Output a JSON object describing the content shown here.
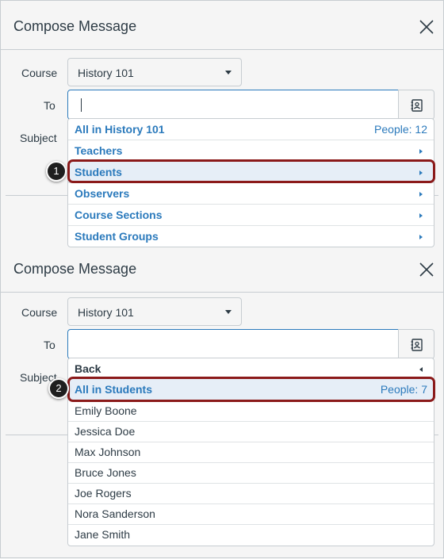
{
  "panel1": {
    "title": "Compose Message",
    "course_label": "Course",
    "course_value": "History 101",
    "to_label": "To",
    "subject_label": "Subject",
    "menu": [
      {
        "label": "All in History 101",
        "right": "People: 12",
        "type": "link"
      },
      {
        "label": "Teachers",
        "type": "link",
        "arrow": "right"
      },
      {
        "label": "Students",
        "type": "link",
        "arrow": "right",
        "highlighted": true
      },
      {
        "label": "Observers",
        "type": "link",
        "arrow": "right"
      },
      {
        "label": "Course Sections",
        "type": "link",
        "arrow": "right"
      },
      {
        "label": "Student Groups",
        "type": "link",
        "arrow": "right"
      }
    ],
    "callout": "1"
  },
  "panel2": {
    "title": "Compose Message",
    "course_label": "Course",
    "course_value": "History 101",
    "to_label": "To",
    "subject_label": "Subject",
    "menu": [
      {
        "label": "Back",
        "type": "back",
        "arrow": "left"
      },
      {
        "label": "All in Students",
        "right": "People: 7",
        "type": "link",
        "highlighted": true
      },
      {
        "label": "Emily Boone",
        "type": "plain"
      },
      {
        "label": "Jessica Doe",
        "type": "plain"
      },
      {
        "label": "Max Johnson",
        "type": "plain"
      },
      {
        "label": "Bruce Jones",
        "type": "plain"
      },
      {
        "label": "Joe Rogers",
        "type": "plain"
      },
      {
        "label": "Nora Sanderson",
        "type": "plain"
      },
      {
        "label": "Jane Smith",
        "type": "plain"
      }
    ],
    "callout": "2"
  },
  "colors": {
    "link": "#2b7abc",
    "highlight_border": "#8b1a1a",
    "text": "#2d3b45"
  }
}
